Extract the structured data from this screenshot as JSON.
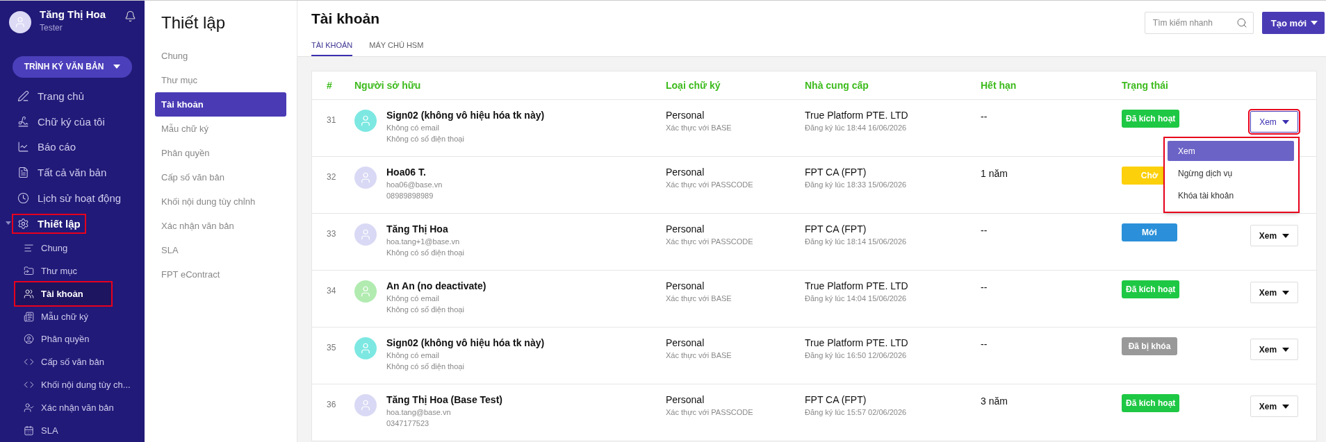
{
  "sidebar": {
    "user": {
      "name": "Tăng Thị Hoa",
      "role": "Tester"
    },
    "primary_button": "TRÌNH KÝ VĂN BẢN",
    "items": [
      {
        "label": "Trang chủ"
      },
      {
        "label": "Chữ ký của tôi"
      },
      {
        "label": "Báo cáo"
      },
      {
        "label": "Tất cả văn bản"
      },
      {
        "label": "Lịch sử hoạt động"
      },
      {
        "label": "Thiết lập",
        "expanded": true,
        "highlighted": true,
        "children": [
          {
            "label": "Chung",
            "selected": false,
            "highlighted": false
          },
          {
            "label": "Thư mục",
            "selected": false,
            "highlighted": false
          },
          {
            "label": "Tài khoản",
            "selected": true,
            "highlighted": true
          },
          {
            "label": "Mẫu chữ ký",
            "selected": false,
            "highlighted": false
          },
          {
            "label": "Phân quyền",
            "selected": false,
            "highlighted": false
          },
          {
            "label": "Cấp số văn bản",
            "selected": false,
            "highlighted": false
          },
          {
            "label": "Khối nội dung tùy ch...",
            "selected": false,
            "highlighted": false
          },
          {
            "label": "Xác nhận văn bản",
            "selected": false,
            "highlighted": false
          },
          {
            "label": "SLA",
            "selected": false,
            "highlighted": false
          }
        ]
      }
    ]
  },
  "settings": {
    "title": "Thiết lập",
    "items": [
      {
        "label": "Chung",
        "selected": false
      },
      {
        "label": "Thư mục",
        "selected": false
      },
      {
        "label": "Tài khoản",
        "selected": true
      },
      {
        "label": "Mẫu chữ ký",
        "selected": false
      },
      {
        "label": "Phân quyền",
        "selected": false
      },
      {
        "label": "Cấp số văn bản",
        "selected": false
      },
      {
        "label": "Khối nội dung tùy chỉnh",
        "selected": false
      },
      {
        "label": "Xác nhận văn bản",
        "selected": false
      },
      {
        "label": "SLA",
        "selected": false
      },
      {
        "label": "FPT eContract",
        "selected": false
      }
    ]
  },
  "main": {
    "title": "Tài khoản",
    "tabs": [
      {
        "label": "TÀI KHOẢN",
        "selected": true
      },
      {
        "label": "MÁY CHỦ HSM",
        "selected": false
      }
    ],
    "search": {
      "placeholder": "Tìm kiếm nhanh"
    },
    "create_button": "Tạo mới",
    "table": {
      "columns": [
        "#",
        "Người sở hữu",
        "Loại chữ ký",
        "Nhà cung cấp",
        "Hết hạn",
        "Trạng thái"
      ],
      "rows": [
        {
          "num": "31",
          "name": "Sign02 (không vô hiệu hóa tk này)",
          "email": "Không có email",
          "phone": "Không có số điện thoại",
          "color": "#7de8e2",
          "type": "Personal",
          "auth": "Xác thực với BASE",
          "provider": "True Platform PTE. LTD",
          "registered": "Đăng ký lúc 18:44 16/06/2026",
          "expiry": "--",
          "status": {
            "label": "Đã kích hoạt",
            "color": "#1ec844"
          },
          "action": {
            "label": "Xem",
            "open": true,
            "highlighted": true,
            "menu": [
              {
                "label": "Xem",
                "selected": true
              },
              {
                "label": "Ngừng dịch vụ",
                "selected": false
              },
              {
                "label": "Khóa tài khoản",
                "selected": false
              }
            ]
          }
        },
        {
          "num": "32",
          "name": "Hoa06 T.",
          "email": "hoa06@base.vn",
          "phone": "08989898989",
          "color": "#d9d9f5",
          "type": "Personal",
          "auth": "Xác thực với PASSCODE",
          "provider": "FPT CA (FPT)",
          "registered": "Đăng ký lúc 18:33 15/06/2026",
          "expiry": "1 năm",
          "status": {
            "label": "Chờ",
            "color": "#fcd00a"
          }
        },
        {
          "num": "33",
          "name": "Tăng Thị Hoa",
          "email": "hoa.tang+1@base.vn",
          "phone": "Không có số điện thoại",
          "color": "#d9d9f5",
          "type": "Personal",
          "auth": "Xác thực với PASSCODE",
          "provider": "FPT CA (FPT)",
          "registered": "Đăng ký lúc 18:14 15/06/2026",
          "expiry": "--",
          "status": {
            "label": "Mới",
            "color": "#2b90d9"
          },
          "action": {
            "label": "Xem",
            "open": false,
            "highlighted": false
          }
        },
        {
          "num": "34",
          "name": "An An (no deactivate)",
          "email": "Không có email",
          "phone": "Không có số điện thoại",
          "color": "#b1ebb0",
          "type": "Personal",
          "auth": "Xác thực với BASE",
          "provider": "True Platform PTE. LTD",
          "registered": "Đăng ký lúc 14:04 15/06/2026",
          "expiry": "--",
          "status": {
            "label": "Đã kích hoạt",
            "color": "#1ec844"
          },
          "action": {
            "label": "Xem",
            "open": false,
            "highlighted": false
          }
        },
        {
          "num": "35",
          "name": "Sign02 (không vô hiệu hóa tk này)",
          "email": "Không có email",
          "phone": "Không có số điện thoại",
          "color": "#7de8e2",
          "type": "Personal",
          "auth": "Xác thực với BASE",
          "provider": "True Platform PTE. LTD",
          "registered": "Đăng ký lúc 16:50 12/06/2026",
          "expiry": "--",
          "status": {
            "label": "Đã bị khóa",
            "color": "#999999"
          },
          "action": {
            "label": "Xem",
            "open": false,
            "highlighted": false
          }
        },
        {
          "num": "36",
          "name": "Tăng Thị Hoa (Base Test)",
          "email": "hoa.tang@base.vn",
          "phone": "0347177523",
          "color": "#d9d9f5",
          "type": "Personal",
          "auth": "Xác thực với PASSCODE",
          "provider": "FPT CA (FPT)",
          "registered": "Đăng ký lúc 15:57 02/06/2026",
          "expiry": "3 năm",
          "status": {
            "label": "Đã kích hoạt",
            "color": "#1ec844"
          },
          "action": {
            "label": "Xem",
            "open": false,
            "highlighted": false
          }
        }
      ]
    }
  }
}
